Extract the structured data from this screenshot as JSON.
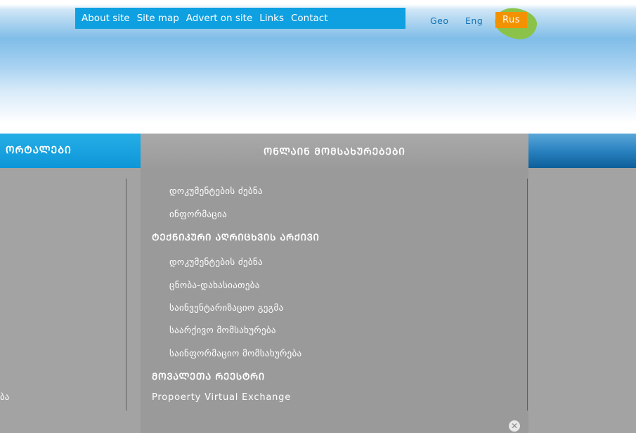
{
  "topnav": {
    "items": [
      "About site",
      "Site map",
      "Advert on site",
      "Links",
      "Contact"
    ]
  },
  "languages": {
    "geo": "Geo",
    "eng": "Eng",
    "rus": "Rus",
    "active": "Rus",
    "active_color": "#f39200",
    "active_blob_color": "#8bc34a"
  },
  "band": {
    "left_tab_label": "ᲝᲠᲢᲐᲚᲔᲑᲘ",
    "panel_title": "ᲝᲜᲚᲐᲘᲜ ᲛᲝᲛᲡᲐᲮᲣᲠᲔᲑᲔᲑᲘ"
  },
  "menu": {
    "items": [
      {
        "label": "დოკუმენტების ძებნა",
        "type": "sub"
      },
      {
        "label": "ინფორმაცია",
        "type": "sub"
      },
      {
        "label": "ᲢᲔᲥᲜᲘᲙᲣᲠᲘ ᲐᲦᲠᲘᲪᲮᲕᲘᲡ ᲐᲠᲥᲘᲕᲘ",
        "type": "head"
      },
      {
        "label": "დოკუმენტების ძებნა",
        "type": "sub"
      },
      {
        "label": "ცნობა-დახასიათება",
        "type": "sub"
      },
      {
        "label": "საინვენტარიზაციო გეგმა",
        "type": "sub"
      },
      {
        "label": "საარქივო მომსახურება",
        "type": "sub"
      },
      {
        "label": "საინფორმაციო მომსახურება",
        "type": "sub"
      },
      {
        "label": "ᲛᲝᲕᲐᲚᲔᲗᲐ ᲠᲔᲔᲡᲢᲠᲘ",
        "type": "head"
      },
      {
        "label": "Propoerty Virtual Exchange",
        "type": "head-latin"
      }
    ]
  },
  "left_partial_text": "ბა",
  "colors": {
    "topnav_bg": "#0ea0e0",
    "band_blue": "#0c8dd0",
    "panel_gray": "#9a9a9a"
  }
}
